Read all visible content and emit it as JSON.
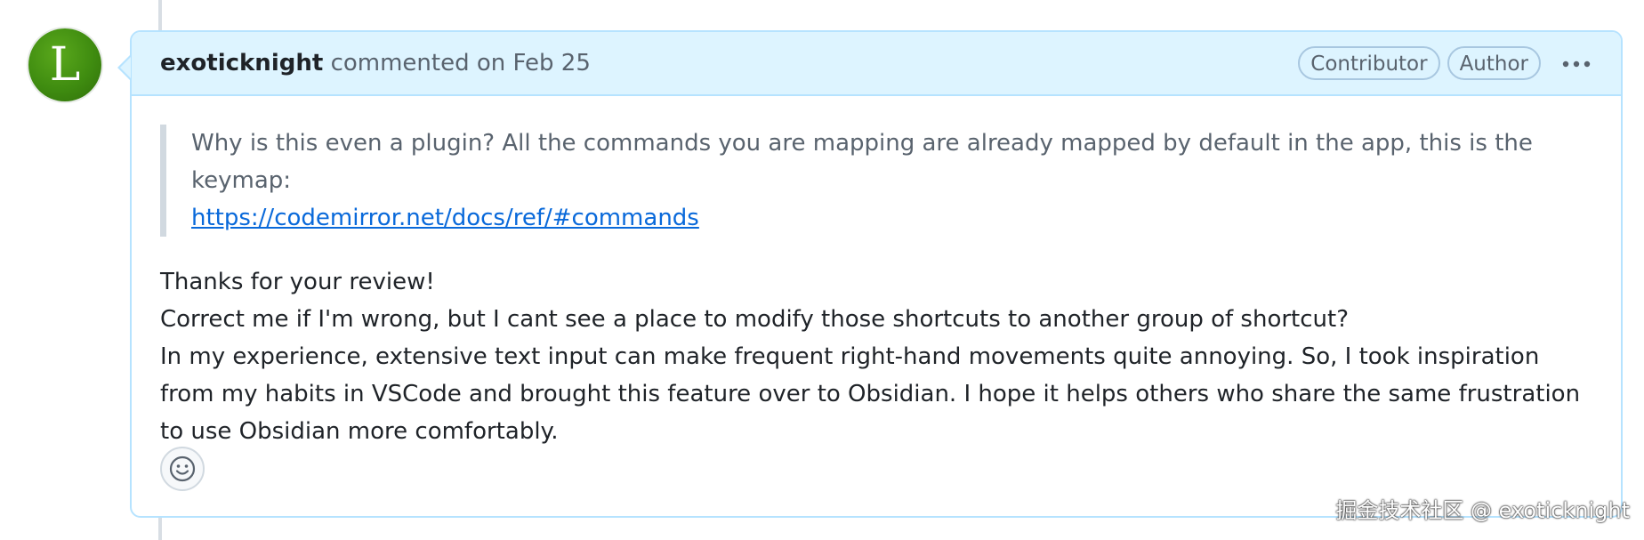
{
  "avatar": {
    "letter": "L",
    "color": "#3f8c10"
  },
  "comment": {
    "author": "exoticknight",
    "meta": "commented on Feb 25",
    "badges": [
      "Contributor",
      "Author"
    ],
    "more_icon": "kebab-horizontal-icon",
    "quote": {
      "text": "Why is this even a plugin? All the commands you are mapping are already mapped by default in the app, this is the keymap:",
      "link": "https://codemirror.net/docs/ref/#commands"
    },
    "paragraphs": [
      "Thanks for your review!",
      "Correct me if I'm wrong, but I cant see a place to modify those shortcuts to another group of shortcut?",
      "In my experience, extensive text input can make frequent right-hand movements quite annoying. So, I took inspiration from my habits in VSCode and brought this feature over to Obsidian. I hope it helps others who share the same frustration to use Obsidian more comfortably."
    ],
    "reaction_icon": "smiley-icon"
  },
  "watermark": "掘金技术社区 @ exoticknight",
  "colors": {
    "header_bg": "#ddf4ff",
    "border": "#b6e3ff",
    "link": "#0969da",
    "muted": "#59636e"
  }
}
